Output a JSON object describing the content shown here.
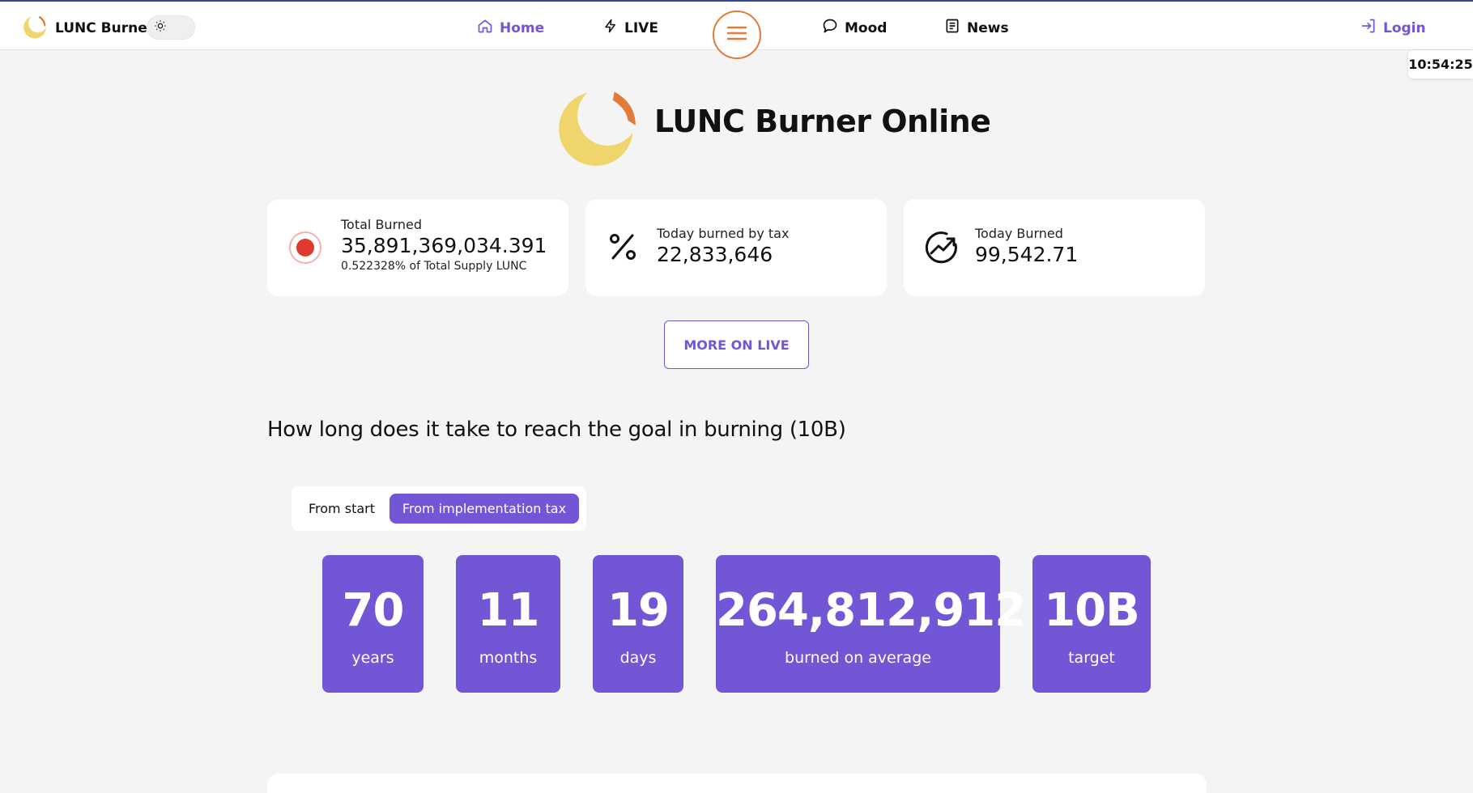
{
  "nav": {
    "brand": "LUNC Burner",
    "home": "Home",
    "live": "LIVE",
    "mood": "Mood",
    "news": "News",
    "login": "Login"
  },
  "clock": "10:54:25",
  "hero": {
    "title": "LUNC Burner Online"
  },
  "stats": {
    "total_burned": {
      "label": "Total Burned",
      "value": "35,891,369,034.391",
      "sub": "0.522328% of Total Supply LUNC"
    },
    "today_tax": {
      "label": "Today burned by tax",
      "value": "22,833,646"
    },
    "today_burned": {
      "label": "Today Burned",
      "value": "99,542.71"
    }
  },
  "more_button": "MORE ON LIVE",
  "goal": {
    "title": "How long does it take to reach the goal in burning (10B)",
    "tabs": [
      "From start",
      "From implementation tax"
    ],
    "active_tab": "From implementation tax",
    "tiles": [
      {
        "value": "70",
        "caption": "years"
      },
      {
        "value": "11",
        "caption": "months"
      },
      {
        "value": "19",
        "caption": "days"
      },
      {
        "value": "264,812,912",
        "caption": "burned on average"
      },
      {
        "value": "10B",
        "caption": "target"
      }
    ]
  },
  "colors": {
    "accent": "#7256d6",
    "menu_ring": "#e07b39",
    "logo_yellow": "#f0d46c",
    "logo_orange": "#e07b39",
    "live_dot": "#e03a2e"
  }
}
